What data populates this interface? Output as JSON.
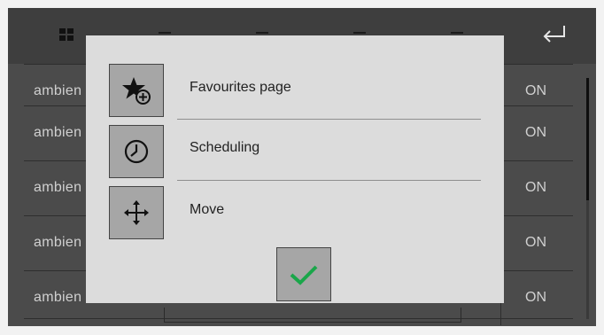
{
  "topbar": {
    "icons": [
      "grid-icon",
      "back-arrow-icon"
    ]
  },
  "list": {
    "rows": [
      {
        "name": "ambien",
        "state": "ON"
      },
      {
        "name": "ambien",
        "state": "ON"
      },
      {
        "name": "ambien",
        "state": "ON"
      },
      {
        "name": "ambien",
        "state": "ON"
      }
    ]
  },
  "dialog": {
    "options": [
      {
        "label": "Favourites page",
        "icon": "star-add-icon"
      },
      {
        "label": "Scheduling",
        "icon": "clock-icon"
      },
      {
        "label": "Move",
        "icon": "move-arrows-icon"
      }
    ],
    "confirm_icon": "checkmark-icon",
    "colors": {
      "dialog_bg": "#dcdcdc",
      "button_bg": "#a6a6a6",
      "check": "#1aa64a",
      "screen_bg": "#4b4b4b"
    }
  }
}
